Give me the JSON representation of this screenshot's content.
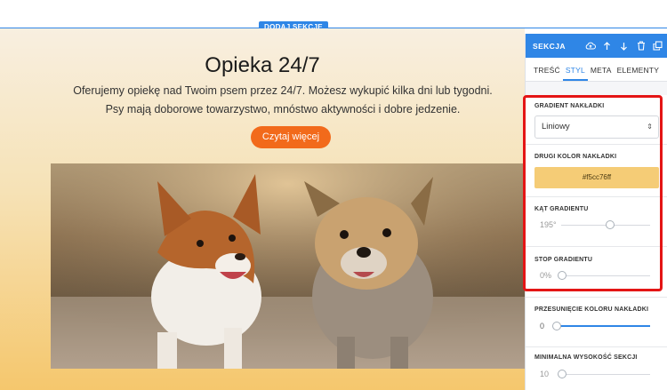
{
  "add_section_label": "DODAJ SEKCJĘ",
  "hero": {
    "title": "Opieka 24/7",
    "description": "Oferujemy opiekę nad Twoim psem przez 24/7. Możesz wykupić kilka dni lub tygodni. Psy mają doborowe towarzystwo, mnóstwo aktywności i dobre jedzenie.",
    "cta_label": "Czytaj więcej",
    "image_subject": "two dogs running"
  },
  "panel": {
    "title": "SEKCJA",
    "header_icons": [
      "cloud-upload-icon",
      "arrow-up-icon",
      "arrow-down-icon",
      "trash-icon",
      "copy-icon"
    ],
    "tabs": [
      {
        "label": "TREŚĆ",
        "active": false
      },
      {
        "label": "STYL",
        "active": true
      },
      {
        "label": "META",
        "active": false
      },
      {
        "label": "ELEMENTY",
        "active": false
      }
    ],
    "gradient_type": {
      "label": "GRADIENT NAKŁADKI",
      "value": "Liniowy"
    },
    "second_color": {
      "label": "DRUGI KOLOR NAKŁADKI",
      "value": "#f5cc76ff",
      "swatch": "#f5cc76"
    },
    "gradient_angle": {
      "label": "KĄT GRADIENTU",
      "value": "195°",
      "fraction": 0.54
    },
    "gradient_stop": {
      "label": "STOP GRADIENTU",
      "value": "0%",
      "fraction": 0.0
    },
    "color_shift": {
      "label": "PRZESUNIĘCIE KOLORU NAKŁADKI",
      "value": "0",
      "fraction": 0.0
    },
    "min_height": {
      "label": "MINIMALNA WYSOKOŚĆ SEKCJI",
      "value": "10",
      "fraction": 0.0
    }
  },
  "colors": {
    "accent": "#2f86e6",
    "cta": "#f26a1b",
    "highlight": "#e41515"
  }
}
